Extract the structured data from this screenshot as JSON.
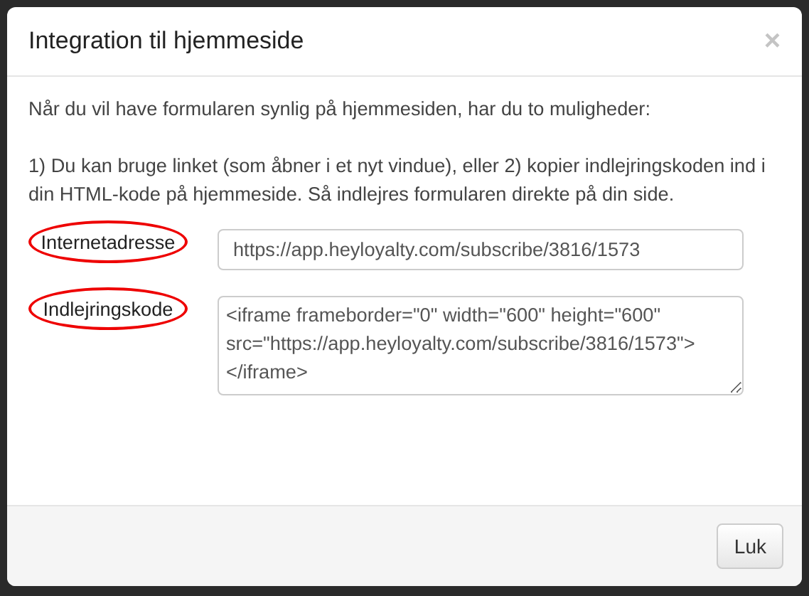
{
  "dialog": {
    "title": "Integration til hjemmeside",
    "close": "×"
  },
  "paragraphs": [
    "Når du vil have formularen synlig på hjemmesiden, har du to muligheder:",
    "1) Du kan bruge linket (som åbner i et nyt vindue), eller 2) kopier indlejringskoden ind i din HTML-kode på hjemmeside. Så indlejres formularen direkte på din side."
  ],
  "fields": [
    {
      "kind": "input",
      "label": "Internetadresse",
      "highlighted": true,
      "value": "https://app.heyloyalty.com/subscribe/3816/1573"
    },
    {
      "kind": "textarea",
      "label": "Indlejringskode",
      "highlighted": true,
      "value": "<iframe frameborder=\"0\" width=\"600\" height=\"600\" src=\"https://app.heyloyalty.com/subscribe/3816/1573\"></iframe>"
    }
  ],
  "buttons": [
    "Luk"
  ]
}
